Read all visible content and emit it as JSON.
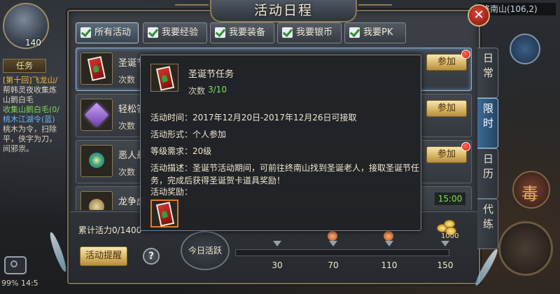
{
  "window": {
    "title": "活动日程",
    "close_icon": "close-icon"
  },
  "hud": {
    "level": "140",
    "quest_tab": "任务",
    "quest_lines": [
      {
        "text": "[第十回]飞龙山/",
        "color": "gold"
      },
      {
        "text": "帮韩灵夜收集炼",
        "color": "white"
      },
      {
        "text": "山鹅白毛",
        "color": "white"
      },
      {
        "text": "收集山鹅白毛(0/",
        "color": "green"
      },
      {
        "text": "桃木江湖令(蓝)",
        "color": "blue"
      },
      {
        "text": "桃木为令，扫除",
        "color": "white"
      },
      {
        "text": "平，侠字为刀，",
        "color": "white"
      },
      {
        "text": "间邪祟。",
        "color": "white"
      }
    ],
    "map_title": "终南山(106,2)",
    "battery": "99%",
    "time_partial": "14:5",
    "skills": [
      "毒"
    ]
  },
  "filters": [
    {
      "label": "所有活动",
      "active": true
    },
    {
      "label": "我要经验",
      "active": false
    },
    {
      "label": "我要装备",
      "active": false
    },
    {
      "label": "我要银币",
      "active": false
    },
    {
      "label": "我要PK",
      "active": false
    }
  ],
  "activities": [
    {
      "name": "圣诞节",
      "count_label": "次数",
      "icon": "christmas-card-icon",
      "button": "参加",
      "notify": true
    },
    {
      "name": "轻松答",
      "count_label": "次数",
      "icon": "crystal-icon",
      "button": "参加",
      "notify": false
    },
    {
      "name": "恶人悬",
      "count_label": "次数",
      "icon": "bounty-icon",
      "button": "参加",
      "notify": true
    },
    {
      "name": "龙争虎",
      "count_label": "",
      "icon": "dragon-icon",
      "time": "15:00"
    }
  ],
  "side_tabs": [
    {
      "label": "日常",
      "active": false
    },
    {
      "label": "限时",
      "active": true
    },
    {
      "label": "日历",
      "active": false
    },
    {
      "label": "代练",
      "active": false
    }
  ],
  "bottom": {
    "vitality_label": "累计活力0/1400",
    "remind_button": "活动提醒",
    "help_label": "?",
    "today_label": "今日活跃",
    "today_count": "0",
    "progress": 0,
    "milestones": [
      "30",
      "70",
      "110",
      "150"
    ],
    "reward_amount": "1000"
  },
  "tooltip": {
    "name": "圣诞节任务",
    "count_label": "次数",
    "count_value": "3/10",
    "time_line": "活动时间：2017年12月20日-2017年12月26日可接取",
    "form_line": "活动形式：个人参加",
    "level_line": "等级需求：20级",
    "desc_line1": "活动描述：圣诞节活动期间，可前往终南山找到圣诞老人，接取圣诞节任",
    "desc_line2": "务，完成后获得圣诞贺卡道具奖励！",
    "reward_label": "活动奖励："
  },
  "colors": {
    "accent_gold": "#d9b768",
    "active_tab_blue": "#3b6a96",
    "count_green": "#7fe05a",
    "notify_red": "#d01a10"
  }
}
